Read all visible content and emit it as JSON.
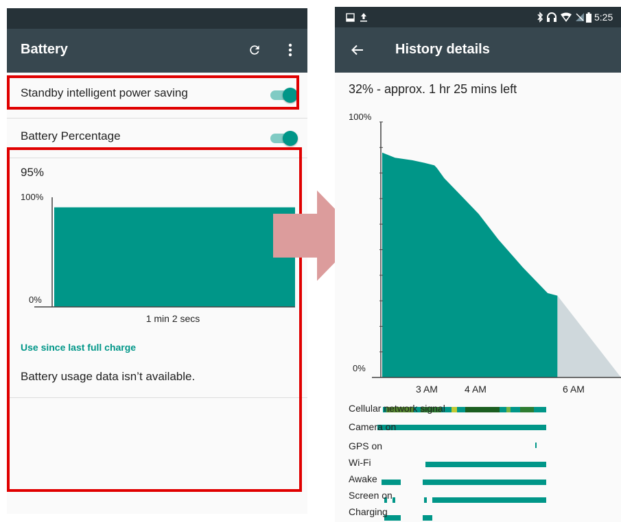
{
  "left_screen": {
    "app_bar": {
      "title": "Battery",
      "refresh_icon": "refresh-icon",
      "more_icon": "more-vert-icon"
    },
    "preferences": [
      {
        "label": "Standby intelligent power saving",
        "enabled": true
      },
      {
        "label": "Battery Percentage",
        "enabled": true
      }
    ],
    "battery_level": "95%",
    "chart": {
      "y_max_label": "100%",
      "y_min_label": "0%",
      "duration_label": "1 min 2 secs",
      "level_percent": 95
    },
    "usage_header": "Use since last full charge",
    "usage_message": "Battery usage data isn’t available."
  },
  "right_screen": {
    "status_bar": {
      "time": "5:25",
      "icons": [
        "image-icon",
        "upload-icon",
        "bluetooth-icon",
        "headphones-icon",
        "wifi-icon",
        "cellular-icon",
        "battery-icon"
      ]
    },
    "app_bar": {
      "title": "History details",
      "back_icon": "arrow-back-icon"
    },
    "summary": "32% - approx. 1 hr 25 mins left",
    "chart_data": {
      "type": "area",
      "y_max_label": "100%",
      "y_min_label": "0%",
      "ylim": [
        0,
        100
      ],
      "x_tick_labels": [
        "3 AM",
        "4 AM",
        "6 AM"
      ],
      "x_tick_hours": [
        3,
        4,
        6
      ],
      "xlim_hours": [
        1.94,
        6.79
      ],
      "series": [
        {
          "hours": [
            1.94,
            2.2,
            2.55,
            2.8,
            3.0,
            3.05,
            3.2,
            3.5,
            3.9,
            4.3,
            4.8,
            5.3,
            5.5
          ],
          "values": [
            88,
            86,
            85,
            84,
            83,
            82,
            78,
            72,
            64,
            54,
            43,
            33,
            32
          ]
        },
        {
          "hours": [
            5.5,
            6.79
          ],
          "values": [
            32,
            0
          ]
        }
      ],
      "colors": {
        "history": "#009688",
        "projection": "#cfd8dc"
      }
    },
    "signal_rows": [
      {
        "label": "Cellular network signal"
      },
      {
        "label": "Camera on"
      },
      {
        "label": "GPS on"
      },
      {
        "label": "Wi-Fi"
      },
      {
        "label": "Awake"
      },
      {
        "label": "Screen on"
      },
      {
        "label": "Charging"
      }
    ]
  },
  "colors": {
    "accent": "#009688",
    "highlight_box": "#e00000",
    "transition_arrow": "#dc9c9c"
  }
}
